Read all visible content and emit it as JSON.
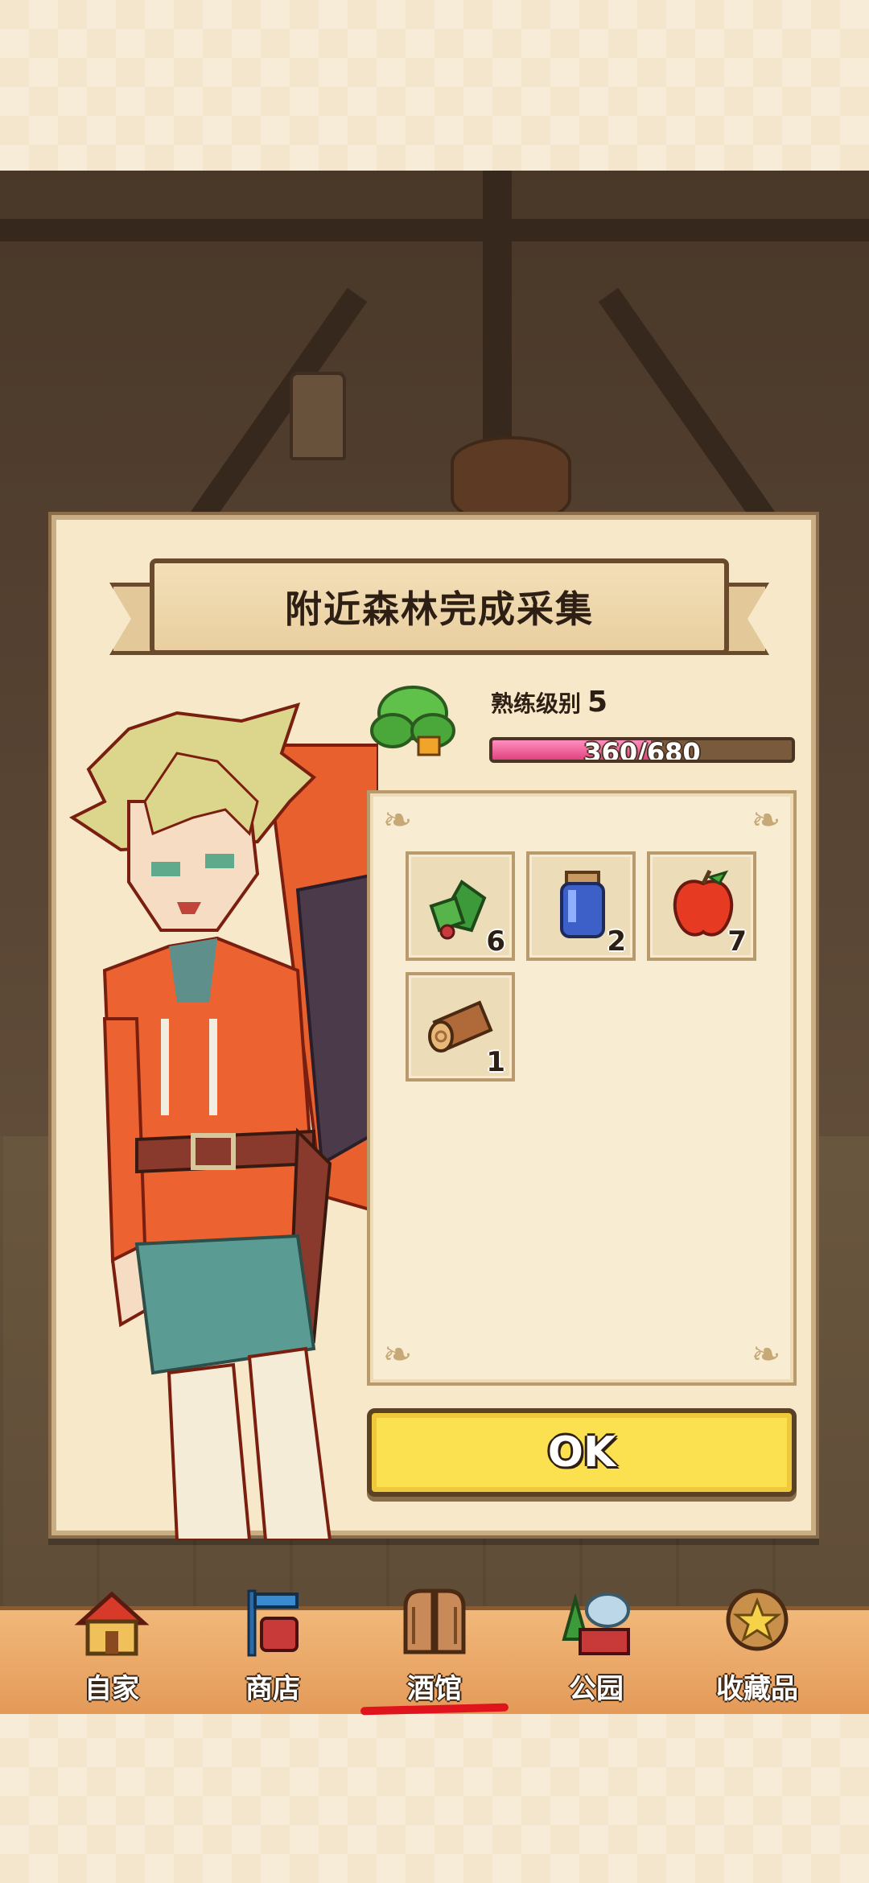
{
  "dialog": {
    "title": "附近森林完成采集",
    "level_label": "熟练级别",
    "level_value": "5",
    "xp_text": "360/680",
    "xp_fraction": 0.53,
    "ok_label": "OK"
  },
  "items": [
    {
      "icon": "herb-leaves-icon",
      "count": "6"
    },
    {
      "icon": "water-jar-icon",
      "count": "2"
    },
    {
      "icon": "apple-icon",
      "count": "7"
    },
    {
      "icon": "wood-log-icon",
      "count": "1"
    }
  ],
  "bottom_nav": [
    {
      "label": "自家",
      "icon": "home-icon"
    },
    {
      "label": "商店",
      "icon": "shop-icon"
    },
    {
      "label": "酒馆",
      "icon": "tavern-icon",
      "active": true
    },
    {
      "label": "公园",
      "icon": "park-icon"
    },
    {
      "label": "收藏品",
      "icon": "collection-medal-icon"
    }
  ],
  "colors": {
    "accent_yellow": "#fbe04f",
    "xp_pink": "#e0437e",
    "active_underline": "#e0141c"
  }
}
